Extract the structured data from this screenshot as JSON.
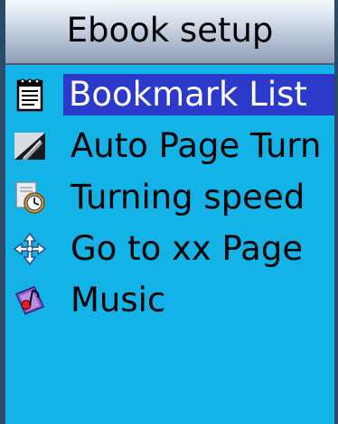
{
  "header": {
    "title": "Ebook setup"
  },
  "menu": {
    "selected_index": 0,
    "items": [
      {
        "label": "Bookmark List",
        "icon": "notepad-icon"
      },
      {
        "label": "Auto Page Turn",
        "icon": "page-curl-icon"
      },
      {
        "label": "Turning speed",
        "icon": "clock-document-icon"
      },
      {
        "label": "Go to xx Page",
        "icon": "move-arrows-icon"
      },
      {
        "label": "Music",
        "icon": "music-note-icon"
      }
    ]
  },
  "colors": {
    "background": "#13b3e8",
    "selection": "#2c3acb",
    "selection_text": "#ffffff"
  }
}
